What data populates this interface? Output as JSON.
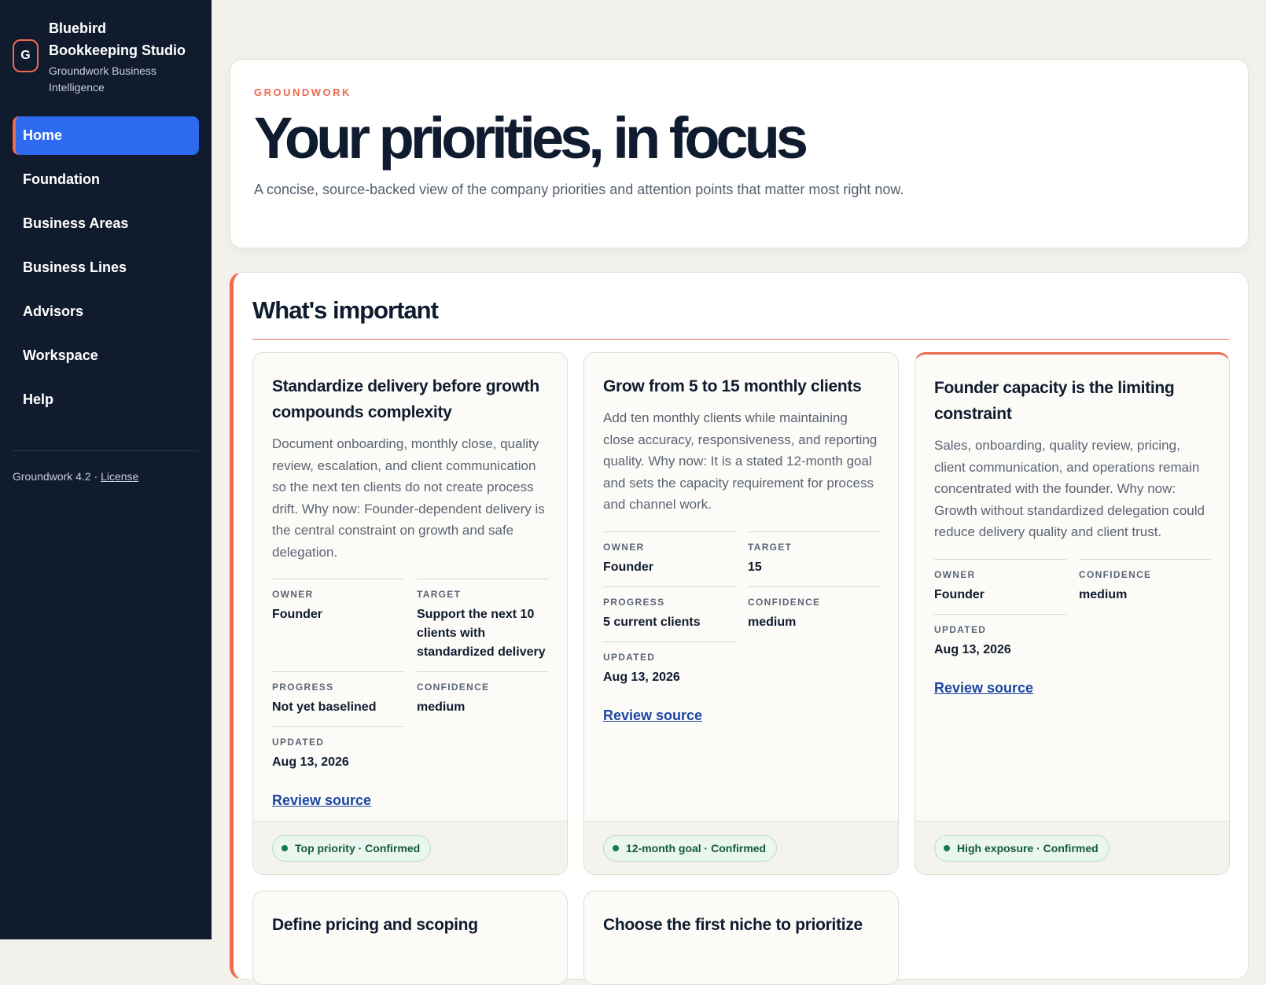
{
  "brand": {
    "mark": "G",
    "name": "Bluebird Bookkeeping Studio",
    "subtitle": "Groundwork Business Intelligence"
  },
  "nav": {
    "items": [
      {
        "label": "Home",
        "active": true
      },
      {
        "label": "Foundation"
      },
      {
        "label": "Business Areas"
      },
      {
        "label": "Business Lines"
      },
      {
        "label": "Advisors"
      },
      {
        "label": "Workspace"
      },
      {
        "label": "Help"
      }
    ]
  },
  "footer": {
    "version": "Groundwork 4.2 · ",
    "license": "License"
  },
  "hero": {
    "eyebrow": "GROUNDWORK",
    "title": "Your priorities, in focus",
    "subtitle": "A concise, source-backed view of the company priorities and attention points that matter most right now."
  },
  "important": {
    "title": "What's important",
    "cards": [
      {
        "title": "Standardize delivery before growth compounds complexity",
        "description": "Document onboarding, monthly close, quality review, escalation, and client communication so the next ten clients do not create process drift. Why now: Founder-dependent delivery is the central constraint on growth and safe delegation.",
        "owner_label": "OWNER",
        "owner": "Founder",
        "target_label": "TARGET",
        "target": "Support the next 10 clients with standardized delivery",
        "progress_label": "PROGRESS",
        "progress": "Not yet baselined",
        "confidence_label": "CONFIDENCE",
        "confidence": "medium",
        "updated_label": "UPDATED",
        "updated": "Aug 13, 2026",
        "link": "Review source",
        "badge": "Top priority · Confirmed"
      },
      {
        "title": "Grow from 5 to 15 monthly clients",
        "description": "Add ten monthly clients while maintaining close accuracy, responsiveness, and reporting quality. Why now: It is a stated 12-month goal and sets the capacity requirement for process and channel work.",
        "owner_label": "OWNER",
        "owner": "Founder",
        "target_label": "TARGET",
        "target": "15",
        "progress_label": "PROGRESS",
        "progress": "5 current clients",
        "confidence_label": "CONFIDENCE",
        "confidence": "medium",
        "updated_label": "UPDATED",
        "updated": "Aug 13, 2026",
        "link": "Review source",
        "badge": "12-month goal · Confirmed"
      },
      {
        "title": "Founder capacity is the limiting constraint",
        "description": "Sales, onboarding, quality review, pricing, client communication, and operations remain concentrated with the founder. Why now: Growth without standardized delegation could reduce delivery quality and client trust.",
        "owner_label": "OWNER",
        "owner": "Founder",
        "confidence_label": "CONFIDENCE",
        "confidence": "medium",
        "updated_label": "UPDATED",
        "updated": "Aug 13, 2026",
        "link": "Review source",
        "badge": "High exposure · Confirmed"
      },
      {
        "title": "Define pricing and scoping"
      },
      {
        "title": "Choose the first niche to prioritize"
      }
    ]
  }
}
